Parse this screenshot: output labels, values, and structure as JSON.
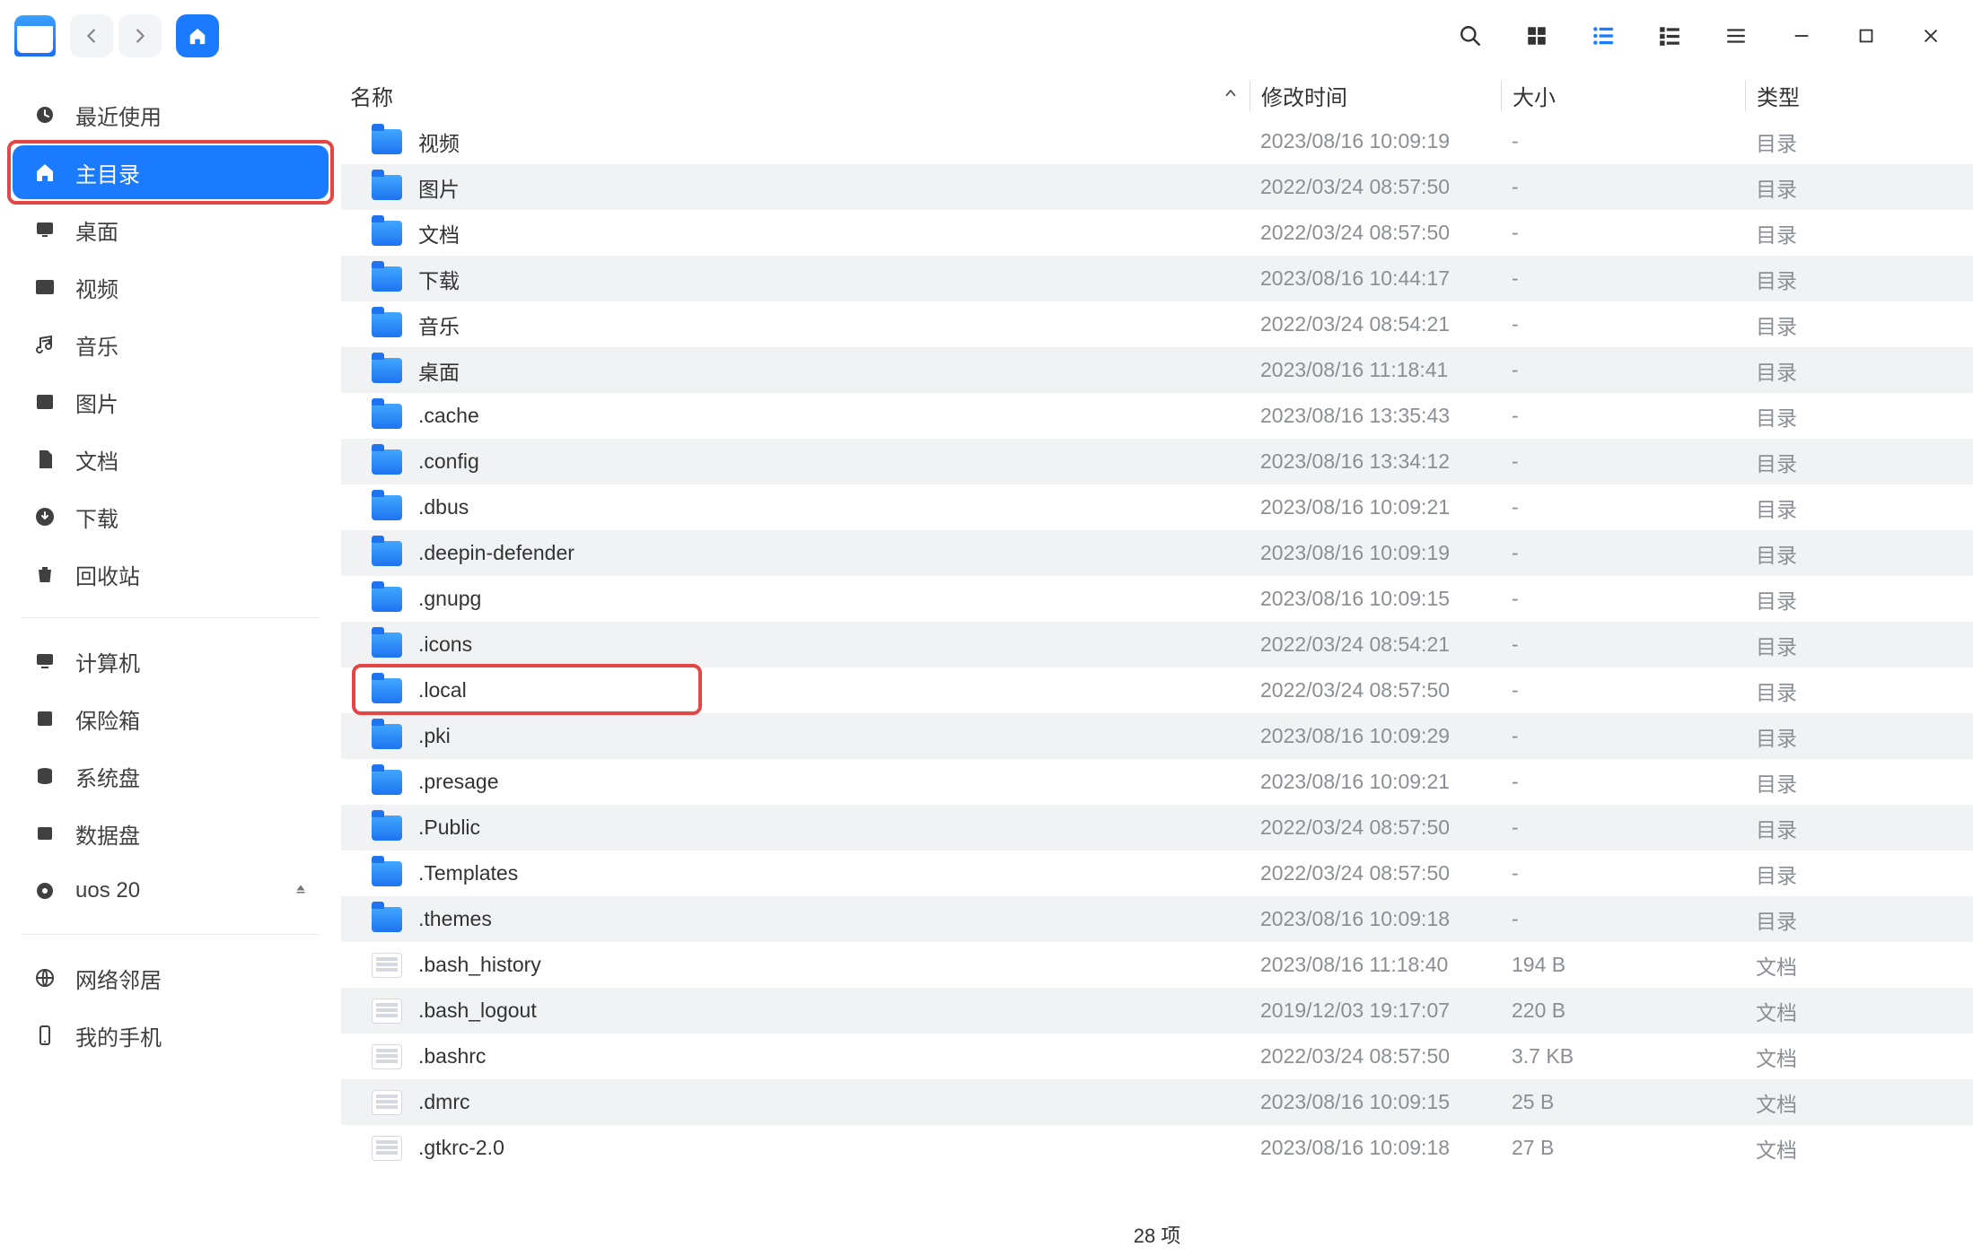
{
  "columns": {
    "name": "名称",
    "mtime": "修改时间",
    "size": "大小",
    "type": "类型"
  },
  "sort": {
    "column": "name",
    "direction": "asc"
  },
  "sidebar": {
    "items": [
      {
        "label": "最近使用",
        "active": false
      },
      {
        "label": "主目录",
        "active": true
      },
      {
        "label": "桌面",
        "active": false
      },
      {
        "label": "视频",
        "active": false
      },
      {
        "label": "音乐",
        "active": false
      },
      {
        "label": "图片",
        "active": false
      },
      {
        "label": "文档",
        "active": false
      },
      {
        "label": "下载",
        "active": false
      },
      {
        "label": "回收站",
        "active": false
      }
    ],
    "group2": [
      {
        "label": "计算机"
      },
      {
        "label": "保险箱"
      },
      {
        "label": "系统盘"
      },
      {
        "label": "数据盘"
      },
      {
        "label": "uos 20",
        "eject": true
      }
    ],
    "group3": [
      {
        "label": "网络邻居"
      },
      {
        "label": "我的手机"
      }
    ]
  },
  "type_labels": {
    "dir": "目录",
    "doc": "文档"
  },
  "files": [
    {
      "name": "视频",
      "mtime": "2023/08/16 10:09:19",
      "size": "-",
      "type": "dir"
    },
    {
      "name": "图片",
      "mtime": "2022/03/24 08:57:50",
      "size": "-",
      "type": "dir"
    },
    {
      "name": "文档",
      "mtime": "2022/03/24 08:57:50",
      "size": "-",
      "type": "dir"
    },
    {
      "name": "下载",
      "mtime": "2023/08/16 10:44:17",
      "size": "-",
      "type": "dir"
    },
    {
      "name": "音乐",
      "mtime": "2022/03/24 08:54:21",
      "size": "-",
      "type": "dir"
    },
    {
      "name": "桌面",
      "mtime": "2023/08/16 11:18:41",
      "size": "-",
      "type": "dir"
    },
    {
      "name": ".cache",
      "mtime": "2023/08/16 13:35:43",
      "size": "-",
      "type": "dir"
    },
    {
      "name": ".config",
      "mtime": "2023/08/16 13:34:12",
      "size": "-",
      "type": "dir"
    },
    {
      "name": ".dbus",
      "mtime": "2023/08/16 10:09:21",
      "size": "-",
      "type": "dir"
    },
    {
      "name": ".deepin-defender",
      "mtime": "2023/08/16 10:09:19",
      "size": "-",
      "type": "dir"
    },
    {
      "name": ".gnupg",
      "mtime": "2023/08/16 10:09:15",
      "size": "-",
      "type": "dir"
    },
    {
      "name": ".icons",
      "mtime": "2022/03/24 08:54:21",
      "size": "-",
      "type": "dir"
    },
    {
      "name": ".local",
      "mtime": "2022/03/24 08:57:50",
      "size": "-",
      "type": "dir",
      "annotated": true
    },
    {
      "name": ".pki",
      "mtime": "2023/08/16 10:09:29",
      "size": "-",
      "type": "dir"
    },
    {
      "name": ".presage",
      "mtime": "2023/08/16 10:09:21",
      "size": "-",
      "type": "dir"
    },
    {
      "name": ".Public",
      "mtime": "2022/03/24 08:57:50",
      "size": "-",
      "type": "dir"
    },
    {
      "name": ".Templates",
      "mtime": "2022/03/24 08:57:50",
      "size": "-",
      "type": "dir"
    },
    {
      "name": ".themes",
      "mtime": "2023/08/16 10:09:18",
      "size": "-",
      "type": "dir"
    },
    {
      "name": ".bash_history",
      "mtime": "2023/08/16 11:18:40",
      "size": "194 B",
      "type": "doc"
    },
    {
      "name": ".bash_logout",
      "mtime": "2019/12/03 19:17:07",
      "size": "220 B",
      "type": "doc"
    },
    {
      "name": ".bashrc",
      "mtime": "2022/03/24 08:57:50",
      "size": "3.7 KB",
      "type": "doc"
    },
    {
      "name": ".dmrc",
      "mtime": "2023/08/16 10:09:15",
      "size": "25 B",
      "type": "doc"
    },
    {
      "name": ".gtkrc-2.0",
      "mtime": "2023/08/16 10:09:18",
      "size": "27 B",
      "type": "doc"
    }
  ],
  "status": {
    "count_text": "28 项"
  },
  "annotations": {
    "sidebar_highlight_index": 1,
    "row_highlight_name": ".local"
  }
}
